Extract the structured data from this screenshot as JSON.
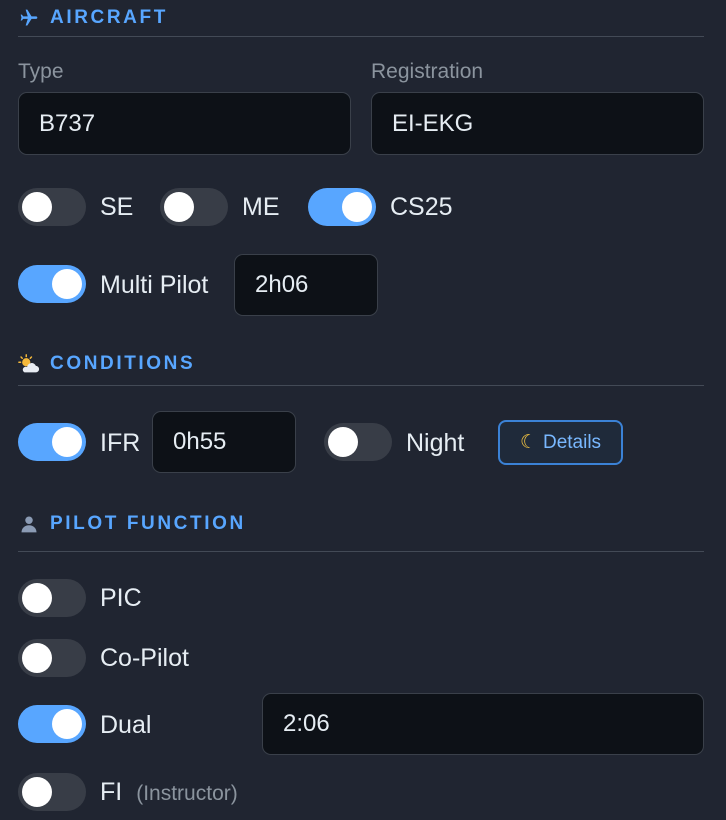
{
  "aircraft": {
    "icon": "airplane-icon",
    "title": "AIRCRAFT",
    "type_label": "Type",
    "type_value": "B737",
    "registration_label": "Registration",
    "registration_value": "EI-EKG",
    "toggles": {
      "se": {
        "label": "SE",
        "on": false
      },
      "me": {
        "label": "ME",
        "on": false
      },
      "cs25": {
        "label": "CS25",
        "on": true
      },
      "multi_pilot": {
        "label": "Multi Pilot",
        "on": true
      }
    },
    "multi_pilot_time": "2h06"
  },
  "conditions": {
    "icon": "sun-behind-cloud-icon",
    "title": "CONDITIONS",
    "ifr": {
      "label": "IFR",
      "on": true,
      "time": "0h55"
    },
    "night": {
      "label": "Night",
      "on": false
    },
    "details_label": "Details",
    "details_icon": "moon-icon"
  },
  "pilot_function": {
    "icon": "person-icon",
    "title": "PILOT FUNCTION",
    "pic": {
      "label": "PIC",
      "on": false
    },
    "copilot": {
      "label": "Co-Pilot",
      "on": false
    },
    "dual": {
      "label": "Dual",
      "on": true,
      "time": "2:06"
    },
    "fi": {
      "label": "FI",
      "hint": "(Instructor)",
      "on": false
    }
  },
  "colors": {
    "background": "#202531",
    "accent": "#58a6ff",
    "input_bg": "#0d1117",
    "toggle_off": "#383d47"
  }
}
